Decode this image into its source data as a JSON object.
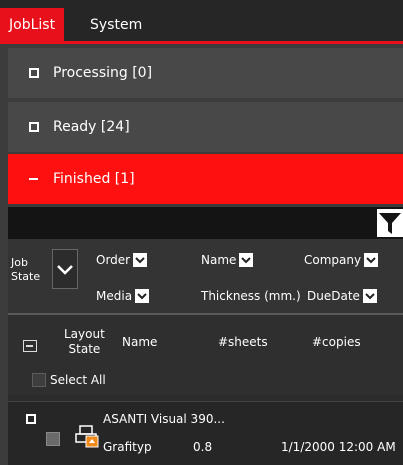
{
  "menu": {
    "tabs": [
      {
        "label": "JobList",
        "active": true
      },
      {
        "label": "System",
        "active": false
      }
    ]
  },
  "sections": [
    {
      "label": "Processing [0]",
      "expanded": false
    },
    {
      "label": "Ready [24]",
      "expanded": false
    },
    {
      "label": "Finished [1]",
      "expanded": true
    }
  ],
  "column_chooser": {
    "job_state_line1": "Job",
    "job_state_line2": "State",
    "row1": [
      "Order",
      "Name",
      "Company"
    ],
    "row2": [
      "Media",
      "Thickness (mm.)",
      "DueDate"
    ]
  },
  "table": {
    "headers": {
      "layout_state_line1": "Layout",
      "layout_state_line2": "State",
      "name": "Name",
      "sheets": "#sheets",
      "copies": "#copies"
    },
    "select_all": "Select All",
    "rows": [
      {
        "name": "ASANTI Visual 390...",
        "media": "Grafityp",
        "thickness": "0.8",
        "due_date": "1/1/2000 12:00 AM"
      }
    ]
  },
  "colors": {
    "accent": "#e8101a",
    "section_active": "#ff1010",
    "section_bg": "#484848",
    "icon_orange": "#f08a1c"
  },
  "icons": {
    "filter": "funnel-icon",
    "job": "printer-layout-icon"
  }
}
